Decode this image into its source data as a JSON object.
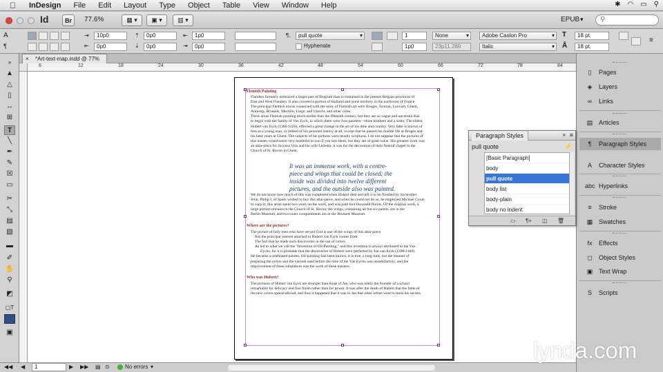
{
  "menubar": {
    "app": "InDesign",
    "items": [
      "File",
      "Edit",
      "Layout",
      "Type",
      "Object",
      "Table",
      "View",
      "Window",
      "Help"
    ]
  },
  "appbar": {
    "logo": "Id",
    "bridge": "Br",
    "zoom": "77.6%",
    "workspace": "EPUB",
    "search_placeholder": ""
  },
  "control": {
    "space_before": "0p0",
    "space_after": "0p0",
    "left_indent": "1p0",
    "right_indent": "0p0",
    "first_indent": "10p0",
    "last_indent": "0p0",
    "para_style": "pull quote",
    "hyphenate": "Hyphenate",
    "drop_lines": "1",
    "drop_chars": "1p0",
    "char_style": "None",
    "coords": "23p11.289",
    "font": "Adobe Caslon Pro",
    "font_style": "Italic",
    "size": "18 pt",
    "leading": "18 pt"
  },
  "document": {
    "tab_title": "*Art-text-map.indd @ 77%",
    "close": "×",
    "ruler_ticks": [
      "6",
      "12",
      "18",
      "24",
      "30",
      "36",
      "42",
      "48",
      "54",
      "60",
      "66",
      "72",
      "78",
      "84"
    ],
    "page_number": "1",
    "errors": "No errors",
    "heading1": "Flemish Painting",
    "body1": [
      "Flanders formerly embraced a larger part of Belgium than is contained in the present Belgian provinces of",
      "East and West Flanders. It also covered a portion of Holland and some territory in the northwest of France.",
      "The principal Flemish towns connected with the story of Flemish art were Bruges, Tournai, Louvain, Ghent,",
      "Antwerp, Brussels, Mechlin, Liege, and Utrecht, and other cities.",
      "There arose Flemish painting much earlier than the fifteenth century, but they are so vague and uncertain that",
      "to begin with the family of Van Eyck, in which there were four painters—three brothers and a sister. The eldest,",
      "Hubert van Eyck (1366-1426), effected a great change in the art of his time and country. Very little is known of",
      "him as a young man, or indeed of his personal history at all, except that he passed his middle life at Bruges and",
      "his later years at Ghent. The subjects of his pictures were mostly scriptural. I do not suppose that the pictures of",
      "this master would seem very beautiful to you if you saw them, but they are of great value. His greatest work was",
      "an altar-piece for Jocosus Vyts and his wife Lisbetta; it was for the decoration of their funeral chapel in the",
      "Church of St. Bavon in Ghent."
    ],
    "pullquote": [
      "It was an immense work, with a centre-",
      "piece and wings that could be closed; the",
      "inside was divided into twelve different",
      "pictures, and the outside also was painted."
    ],
    "body2": [
      "We do not know how much of this was completed when Hubert died and left it to be finished by his brother",
      "John. Philip I. of Spain wished to buy this altar-piece, and when he could not do so, he employed Michael Coxie",
      "to copy it; this artist spent two years on the work, and was paid four thousand florins. Of the original work, a",
      "large portion remains in the Church of St. Bavon; the wings, containing all but six panels, are in the",
      "Berlin Museum, and two outer compartments are in the Brussels Museum."
    ],
    "heading2": "Where are the pictures?",
    "body3": [
      "The picture of holy men who have served God is one of the wings of this altar-piece.",
      "But the principal interest attached to Hubert van Eyck comes from",
      "The fact that he made such discoveries in the use of colors",
      "As led to what we call the \"Invention of Oil-Painting,\" and this invention is always attributed to the Van",
      "Eycks, for it is probable that the discoveries of Hubert were perfected by Jan van Eyck (1390-1440).",
      "He became a celebrated painter. Oil-painting had been known, it is true, a long time, but the manner of",
      "preparing the colors and the varnish used before the time of the Van Eycks was unsatisfactory, and the",
      "improvement of these substances was the work of these masters."
    ],
    "heading3": "Who was Hubert?",
    "body4": [
      "The pictures of Hubert van Eyck are stronger than those of Jan, who was really the founder of a school",
      "remarkable for delicacy and fine finish rather than for power. It was after the death of Hubert that the fame of",
      "the new colors spread abroad, and thus it happened that it was to Jan that other artists went to learn his secrets."
    ]
  },
  "dock": {
    "items": [
      "Pages",
      "Layers",
      "Links",
      "Articles",
      "Paragraph Styles",
      "Character Styles",
      "Hyperlinks",
      "Stroke",
      "Swatches",
      "Effects",
      "Object Styles",
      "Text Wrap",
      "Scripts"
    ],
    "active": "Paragraph Styles"
  },
  "paragraph_styles_panel": {
    "title": "Paragraph Styles",
    "current_style": "pull quote",
    "rows": [
      "[Basic Paragraph]",
      "body",
      "pull quote",
      "body list",
      "body-plain",
      "body no indent"
    ],
    "selected": "pull quote"
  },
  "watermark": "lynda.com"
}
